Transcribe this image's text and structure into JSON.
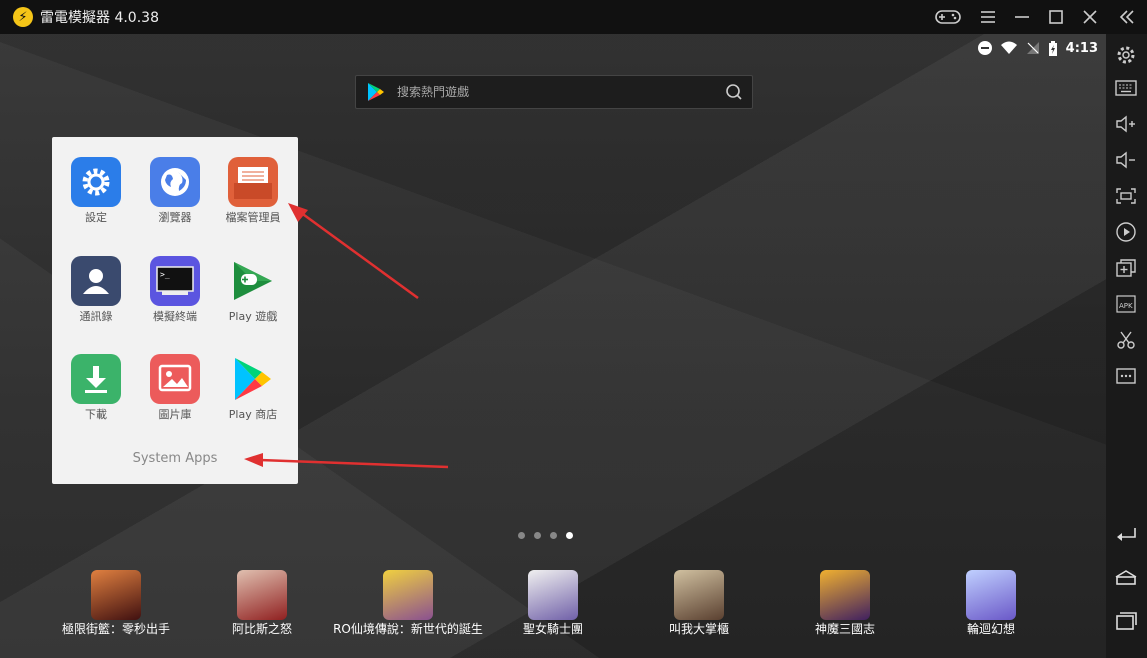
{
  "window": {
    "title": "雷電模擬器 4.0.38",
    "controls": [
      "gamepad-icon",
      "menu-icon",
      "minimize-icon",
      "maximize-icon",
      "close-icon",
      "collapse-icon"
    ]
  },
  "statusbar": {
    "time": "4:13"
  },
  "search": {
    "placeholder": "搜索熱門遊戲"
  },
  "folder": {
    "name": "System Apps",
    "apps": [
      {
        "label": "設定",
        "color": "#2b7de9"
      },
      {
        "label": "瀏覽器",
        "color": "#4a7ee8"
      },
      {
        "label": "檔案管理員",
        "color": "#e0603a"
      },
      {
        "label": "通訊錄",
        "color": "#3a4a6e"
      },
      {
        "label": "模擬終端",
        "color": "#5b55e0"
      },
      {
        "label": "Play 遊戲",
        "color": "#1e8e3e"
      },
      {
        "label": "下載",
        "color": "#3bb36a"
      },
      {
        "label": "圖片庫",
        "color": "#ec5b5b"
      },
      {
        "label": "Play 商店",
        "color": "#00a1f1"
      }
    ]
  },
  "dock": [
    {
      "label": "極限街籃：零秒出手",
      "color": "#b04020"
    },
    {
      "label": "阿比斯之怒",
      "color": "#b03030"
    },
    {
      "label": "RO仙境傳說：新世代的誕生",
      "color": "#e0a020"
    },
    {
      "label": "聖女騎士團",
      "color": "#8a78b8"
    },
    {
      "label": "叫我大掌櫃",
      "color": "#8a7050"
    },
    {
      "label": "神魔三國志",
      "color": "#7050a0"
    },
    {
      "label": "輪迴幻想",
      "color": "#9aa8e8"
    }
  ],
  "pages": {
    "count": 4,
    "active": 4
  }
}
